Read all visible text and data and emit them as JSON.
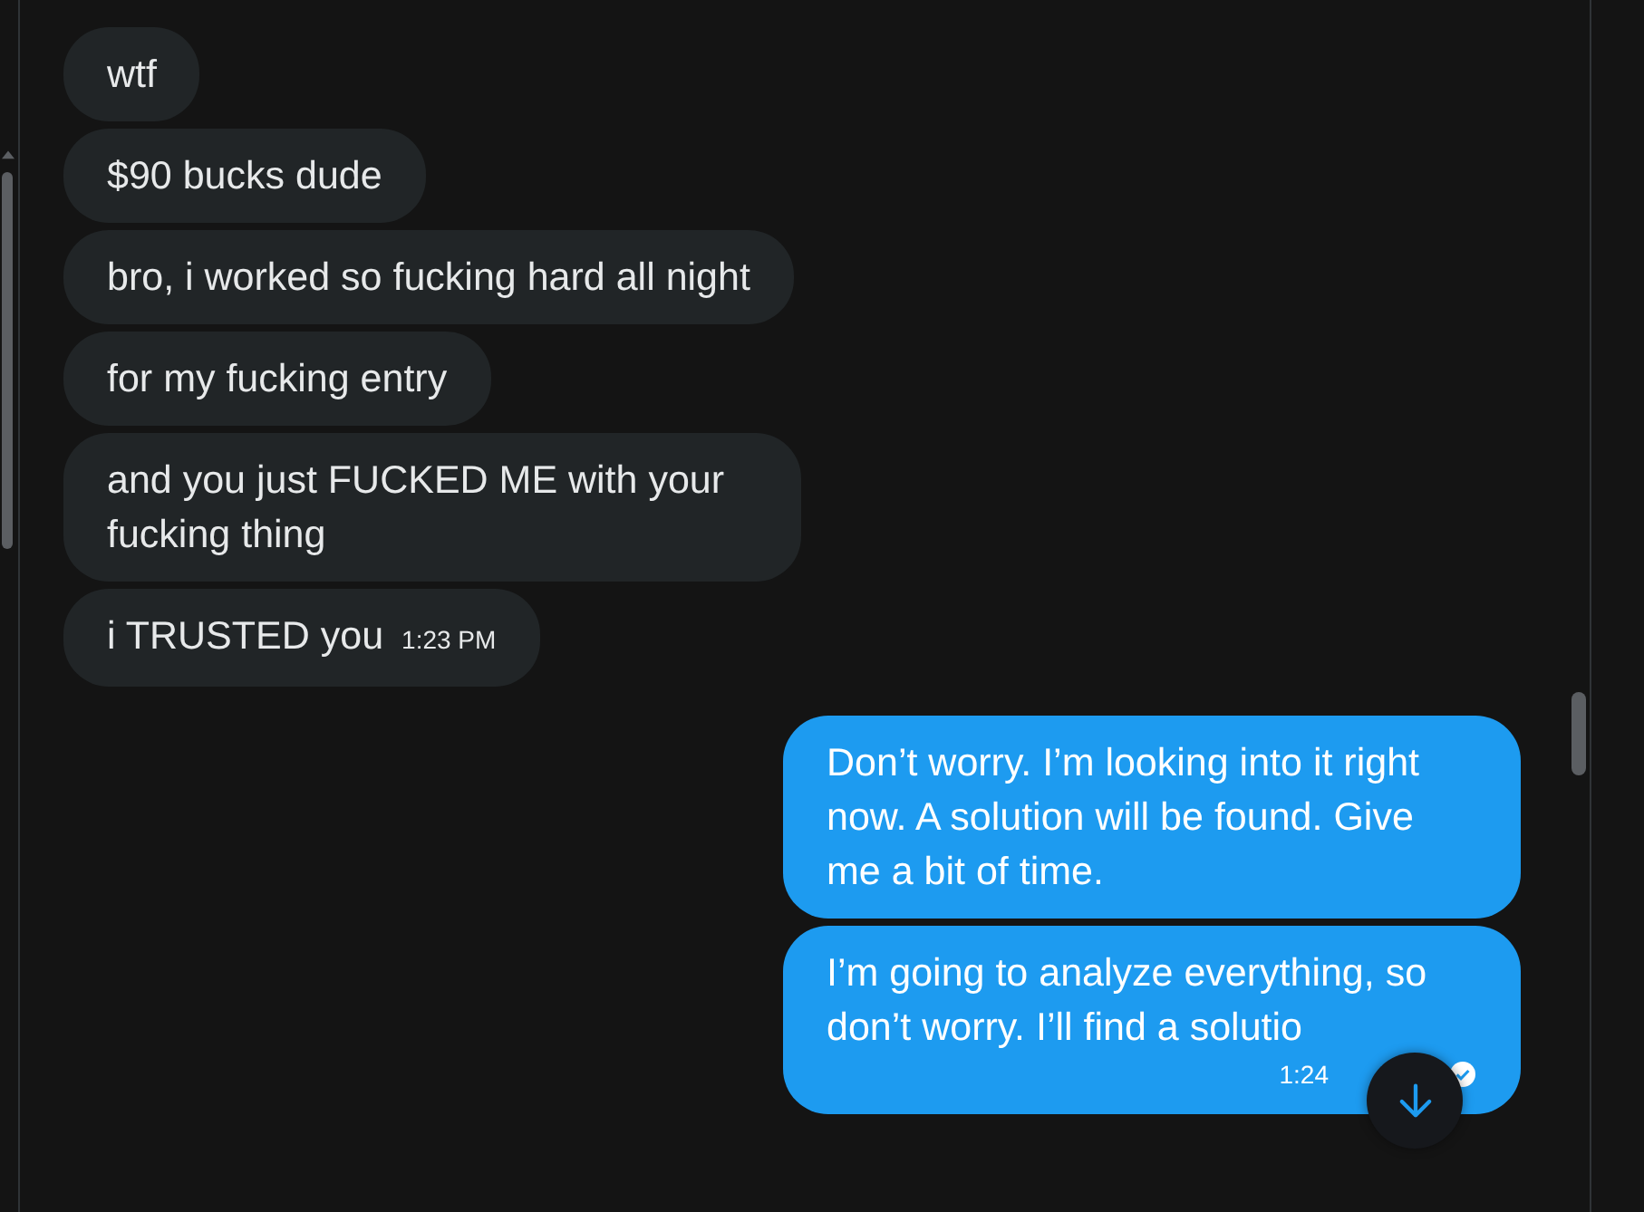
{
  "messages": [
    {
      "kind": "received",
      "text": "wtf"
    },
    {
      "kind": "received",
      "text": "$90 bucks dude"
    },
    {
      "kind": "received",
      "text": "bro, i worked so fucking hard all night"
    },
    {
      "kind": "received",
      "text": "for my fucking entry"
    },
    {
      "kind": "received",
      "text": "and you just FUCKED ME with your fucking thing"
    },
    {
      "kind": "received",
      "text": "i TRUSTED you",
      "time": "1:23 PM"
    },
    {
      "kind": "sent",
      "text": "Don’t worry. I’m looking into it right now. A solution will be found. Give me a bit of time."
    },
    {
      "kind": "sent",
      "text": "I’m going to analyze everything, so don’t worry. I’ll find a solutio",
      "time": "1:24",
      "read": true
    }
  ]
}
